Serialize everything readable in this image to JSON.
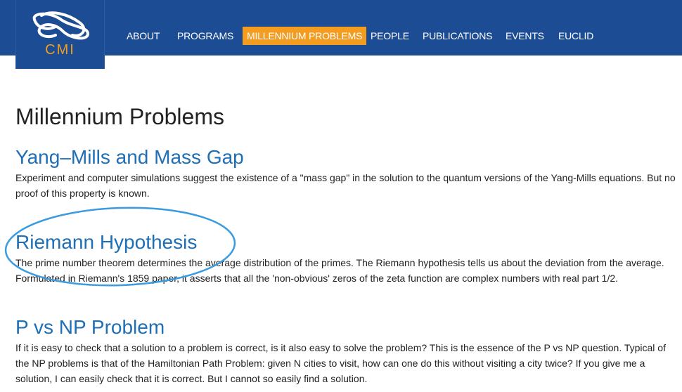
{
  "header": {
    "logo_text": "CMI",
    "nav": [
      {
        "label": "ABOUT",
        "active": false
      },
      {
        "label": "PROGRAMS",
        "active": false
      },
      {
        "label": "MILLENNIUM PROBLEMS",
        "active": true
      },
      {
        "label": "PEOPLE",
        "active": false
      },
      {
        "label": "PUBLICATIONS",
        "active": false
      },
      {
        "label": "EVENTS",
        "active": false
      },
      {
        "label": "EUCLID",
        "active": false
      }
    ]
  },
  "main": {
    "title": "Millennium Problems",
    "problems": [
      {
        "title": "Yang–Mills and Mass Gap",
        "description": "Experiment and computer simulations suggest the existence of a \"mass gap\" in the solution to the quantum versions of the Yang-Mills equations. But no proof of this property is known."
      },
      {
        "title": "Riemann Hypothesis",
        "description": "The prime number theorem determines the average distribution of the primes. The Riemann hypothesis tells us about the deviation from the average. Formulated in Riemann's 1859 paper, it asserts that all the 'non-obvious' zeros of the zeta function are complex numbers with real part 1/2."
      },
      {
        "title": "P vs NP Problem",
        "description": "If it is easy to check that a solution to a problem is correct, is it also easy to solve the problem? This is the essence of the P vs NP question. Typical of the NP problems is that of the Hamiltonian Path Problem: given N cities to visit, how can one do this without visiting a city twice? If you give me a solution, I can easily check that it is correct. But I cannot so easily find a solution."
      }
    ]
  },
  "colors": {
    "header_bg": "#1b4c94",
    "accent": "#f39c1f",
    "link": "#1f6fb6",
    "annotation": "#3a9be0"
  }
}
